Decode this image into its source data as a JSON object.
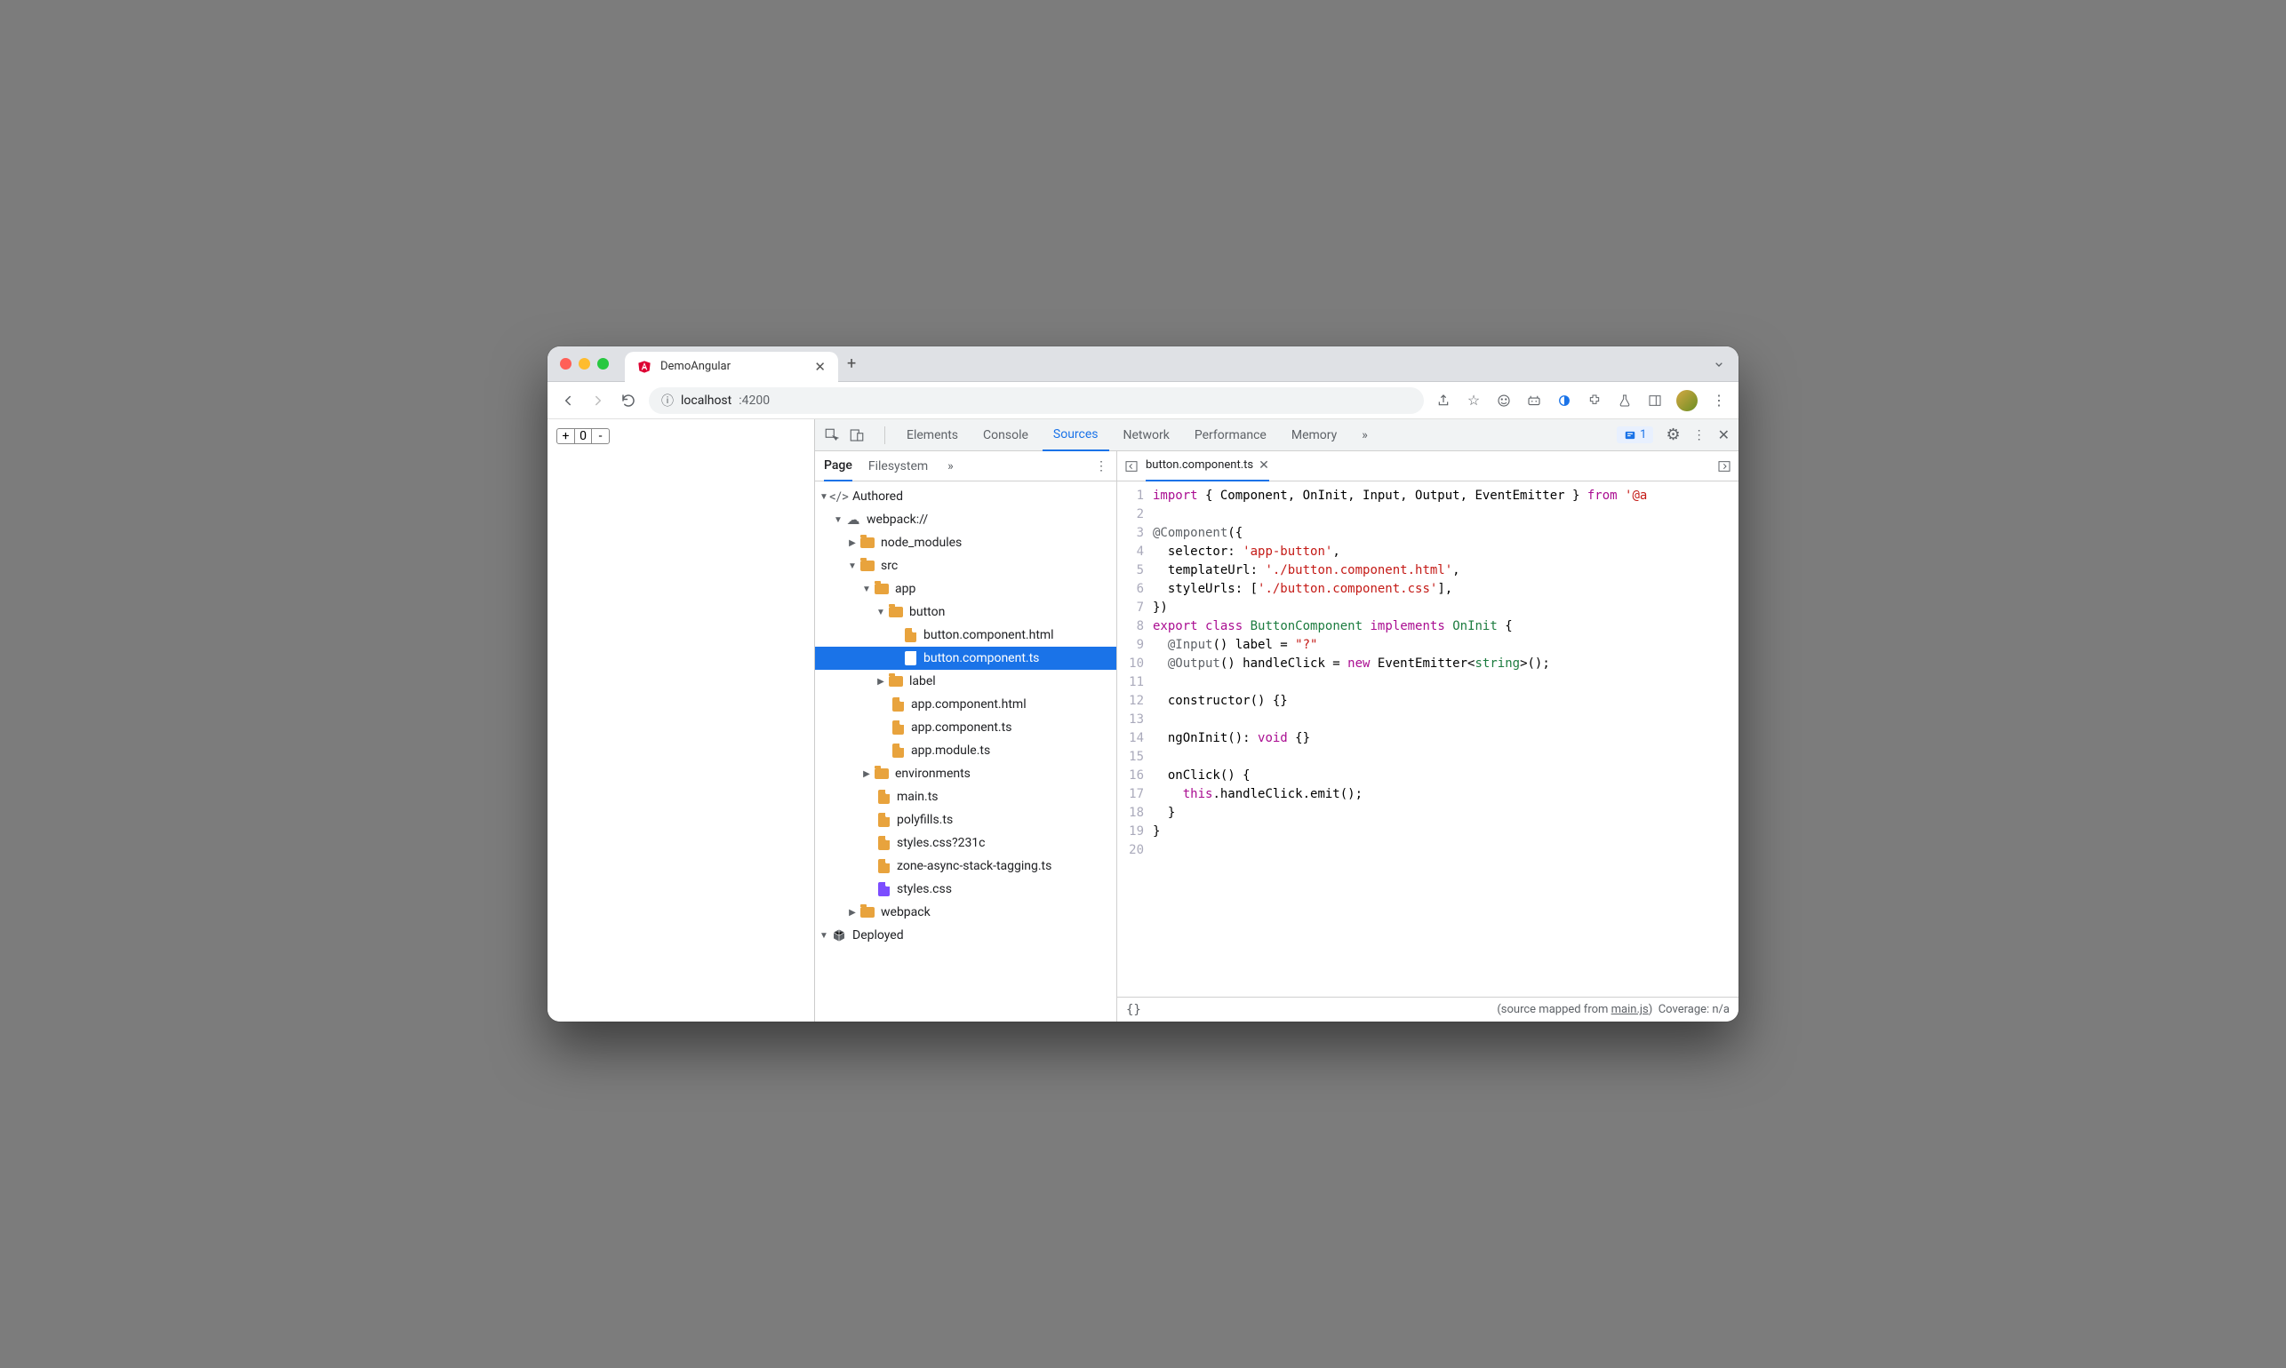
{
  "browser": {
    "tab_title": "DemoAngular",
    "url_host": "localhost",
    "url_port": ":4200"
  },
  "page": {
    "counter_minus": "-",
    "counter_value": "0",
    "counter_plus": "+"
  },
  "devtools": {
    "tabs": [
      "Elements",
      "Console",
      "Sources",
      "Network",
      "Performance",
      "Memory"
    ],
    "active_tab": "Sources",
    "overflow_glyph": "»",
    "issues_count": "1"
  },
  "sources": {
    "subtabs": [
      "Page",
      "Filesystem"
    ],
    "active_subtab": "Page",
    "overflow_glyph": "»",
    "tree": {
      "authored": "Authored",
      "webpack": "webpack://",
      "node_modules": "node_modules",
      "src": "src",
      "app": "app",
      "button": "button",
      "button_html": "button.component.html",
      "button_ts": "button.component.ts",
      "label": "label",
      "app_html": "app.component.html",
      "app_ts": "app.component.ts",
      "app_module": "app.module.ts",
      "environments": "environments",
      "main_ts": "main.ts",
      "polyfills": "polyfills.ts",
      "styles_q": "styles.css?231c",
      "zone": "zone-async-stack-tagging.ts",
      "styles_css": "styles.css",
      "webpack_folder": "webpack",
      "deployed": "Deployed"
    }
  },
  "editor": {
    "filename": "button.component.ts",
    "lines": [
      {
        "n": "1",
        "html": "<span class='kw'>import</span> { Component, OnInit, Input, Output, EventEmitter } <span class='kw'>from</span> <span class='str'>'@a</span>"
      },
      {
        "n": "2",
        "html": ""
      },
      {
        "n": "3",
        "html": "<span class='at'>@Component</span>({"
      },
      {
        "n": "4",
        "html": "  selector: <span class='str'>'app-button'</span>,"
      },
      {
        "n": "5",
        "html": "  templateUrl: <span class='str'>'./button.component.html'</span>,"
      },
      {
        "n": "6",
        "html": "  styleUrls: [<span class='str'>'./button.component.css'</span>],"
      },
      {
        "n": "7",
        "html": "})"
      },
      {
        "n": "8",
        "html": "<span class='kw'>export</span> <span class='kw'>class</span> <span class='cls'>ButtonComponent</span> <span class='kw'>implements</span> <span class='type'>OnInit</span> {"
      },
      {
        "n": "9",
        "html": "  <span class='at'>@Input</span>() label = <span class='str'>\"?\"</span>"
      },
      {
        "n": "10",
        "html": "  <span class='at'>@Output</span>() handleClick = <span class='kw'>new</span> EventEmitter&lt;<span class='type'>string</span>&gt;();"
      },
      {
        "n": "11",
        "html": ""
      },
      {
        "n": "12",
        "html": "  constructor() {}"
      },
      {
        "n": "13",
        "html": ""
      },
      {
        "n": "14",
        "html": "  ngOnInit(): <span class='kw'>void</span> {}"
      },
      {
        "n": "15",
        "html": ""
      },
      {
        "n": "16",
        "html": "  onClick() {"
      },
      {
        "n": "17",
        "html": "    <span class='kw'>this</span>.handleClick.emit();"
      },
      {
        "n": "18",
        "html": "  }"
      },
      {
        "n": "19",
        "html": "}"
      },
      {
        "n": "20",
        "html": ""
      }
    ]
  },
  "status": {
    "mapped_prefix": "(source mapped from ",
    "mapped_file": "main.js",
    "mapped_suffix": ")",
    "coverage": "Coverage: n/a"
  }
}
